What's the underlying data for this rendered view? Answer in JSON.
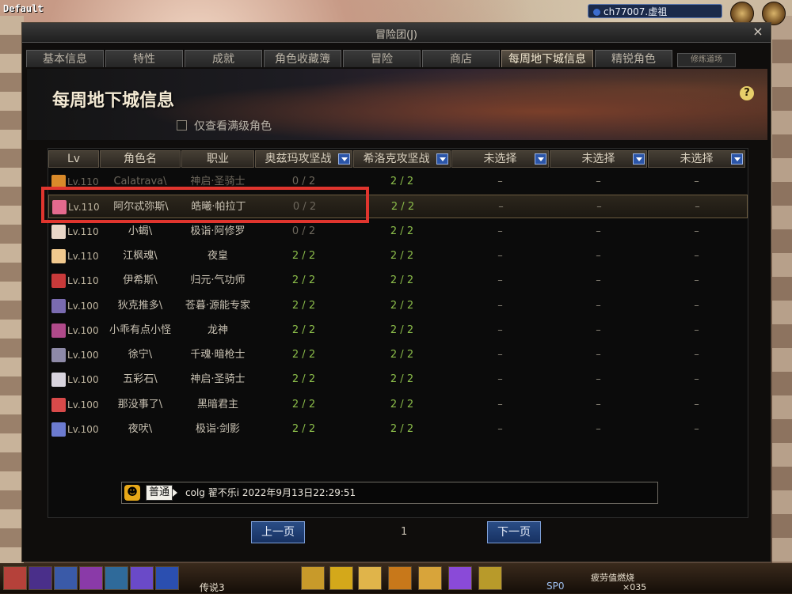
{
  "corner_label": "Default",
  "channel_label": "ch77007.虚祖",
  "window": {
    "title": "冒险团(J)",
    "close_glyph": "×"
  },
  "tabs": [
    {
      "label": "基本信息",
      "active": false
    },
    {
      "label": "特性",
      "active": false
    },
    {
      "label": "成就",
      "active": false
    },
    {
      "label": "角色收藏簿",
      "active": false
    },
    {
      "label": "冒险",
      "active": false
    },
    {
      "label": "商店",
      "active": false
    },
    {
      "label": "每周地下城信息",
      "active": true
    },
    {
      "label": "精锐角色",
      "active": false
    }
  ],
  "tab_extra_label": "修炼道场",
  "section_title": "每周地下城信息",
  "help_glyph": "?",
  "filter_label": "仅查看满级角色",
  "table": {
    "headers": {
      "lv": "Lv",
      "name": "角色名",
      "job": "职业",
      "d1": "奥兹玛攻坚战",
      "d2": "希洛克攻坚战",
      "d3": "未选择",
      "d4": "未选择",
      "d5": "未选择"
    },
    "rows": [
      {
        "lv": "Lv.110",
        "name": "Calatrava\\",
        "job": "神启·圣骑士",
        "d1": "0 / 2",
        "d2": "2 / 2",
        "d3": "–",
        "d4": "–",
        "d5": "–",
        "avatar": "#d98a2a",
        "faded": true
      },
      {
        "lv": "Lv.110",
        "name": "阿尔忒弥斯\\",
        "job": "皓曦·帕拉丁",
        "d1": "0 / 2",
        "d2": "2 / 2",
        "d3": "–",
        "d4": "–",
        "d5": "–",
        "avatar": "#e46a8e",
        "selected": true
      },
      {
        "lv": "Lv.110",
        "name": "小蝎\\",
        "job": "极诣·阿修罗",
        "d1": "0 / 2",
        "d2": "2 / 2",
        "d3": "–",
        "d4": "–",
        "d5": "–",
        "avatar": "#e9d6c7"
      },
      {
        "lv": "Lv.110",
        "name": "江枫魂\\",
        "job": "夜皇",
        "d1": "2 / 2",
        "d2": "2 / 2",
        "d3": "–",
        "d4": "–",
        "d5": "–",
        "avatar": "#f1c98e"
      },
      {
        "lv": "Lv.110",
        "name": "伊希斯\\",
        "job": "归元·气功师",
        "d1": "2 / 2",
        "d2": "2 / 2",
        "d3": "–",
        "d4": "–",
        "d5": "–",
        "avatar": "#c83a3a"
      },
      {
        "lv": "Lv.100",
        "name": "狄克推多\\",
        "job": "苍暮·源能专家",
        "d1": "2 / 2",
        "d2": "2 / 2",
        "d3": "–",
        "d4": "–",
        "d5": "–",
        "avatar": "#7a6bb0"
      },
      {
        "lv": "Lv.100",
        "name": "小乖有点小怪",
        "job": "龙神",
        "d1": "2 / 2",
        "d2": "2 / 2",
        "d3": "–",
        "d4": "–",
        "d5": "–",
        "avatar": "#b04a8a"
      },
      {
        "lv": "Lv.100",
        "name": "徐宁\\",
        "job": "千魂·暗枪士",
        "d1": "2 / 2",
        "d2": "2 / 2",
        "d3": "–",
        "d4": "–",
        "d5": "–",
        "avatar": "#8e8aa8"
      },
      {
        "lv": "Lv.100",
        "name": "五彩石\\",
        "job": "神启·圣骑士",
        "d1": "2 / 2",
        "d2": "2 / 2",
        "d3": "–",
        "d4": "–",
        "d5": "–",
        "avatar": "#d8d4de"
      },
      {
        "lv": "Lv.100",
        "name": "那没事了\\",
        "job": "黑暗君主",
        "d1": "2 / 2",
        "d2": "2 / 2",
        "d3": "–",
        "d4": "–",
        "d5": "–",
        "avatar": "#d84a4a"
      },
      {
        "lv": "Lv.100",
        "name": "夜吠\\",
        "job": "极诣·剑影",
        "d1": "2 / 2",
        "d2": "2 / 2",
        "d3": "–",
        "d4": "–",
        "d5": "–",
        "avatar": "#6c7bd0"
      }
    ]
  },
  "message": {
    "emoji": "☻",
    "channel_tag": "普通",
    "text": "colg 翟不乐i 2022年9月13日22:29:51"
  },
  "pager": {
    "prev": "上一页",
    "page": "1",
    "next": "下一页"
  },
  "hud": {
    "quest_label": "传说3",
    "sp_label": "SP0",
    "gold_label": "×035",
    "status_label": "疲劳值燃烧"
  },
  "colors": {
    "highlight": "#e0352e",
    "complete": "#8bbd4a",
    "incomplete": "#6d675c",
    "button": "#2a4d86"
  }
}
